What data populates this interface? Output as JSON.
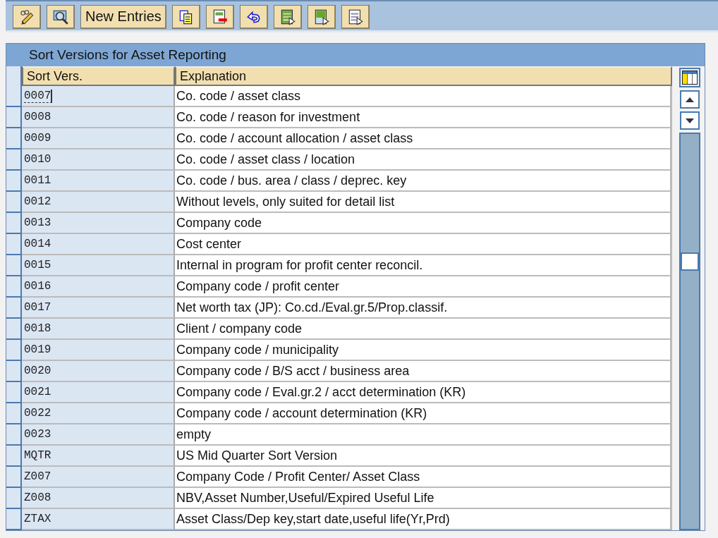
{
  "toolbar": {
    "buttons": [
      {
        "kind": "edit"
      },
      {
        "kind": "display"
      },
      {
        "kind": "text",
        "label": "New Entries"
      },
      {
        "kind": "copy"
      },
      {
        "kind": "delete"
      },
      {
        "kind": "undo"
      },
      {
        "kind": "select-all"
      },
      {
        "kind": "select-block"
      },
      {
        "kind": "deselect"
      }
    ]
  },
  "table": {
    "title": "Sort Versions for Asset Reporting",
    "columns": [
      "Sort Vers.",
      "Explanation"
    ],
    "rows": [
      {
        "code": "0007",
        "explanation": "Co. code / asset class",
        "focused": true
      },
      {
        "code": "0008",
        "explanation": "Co. code / reason for investment",
        "focused": false
      },
      {
        "code": "0009",
        "explanation": "Co. code / account allocation / asset class",
        "focused": false
      },
      {
        "code": "0010",
        "explanation": "Co. code / asset class / location",
        "focused": false
      },
      {
        "code": "0011",
        "explanation": "Co. code / bus. area / class / deprec. key",
        "focused": false
      },
      {
        "code": "0012",
        "explanation": "Without levels, only suited for detail list",
        "focused": false
      },
      {
        "code": "0013",
        "explanation": "Company code",
        "focused": false
      },
      {
        "code": "0014",
        "explanation": "Cost center",
        "focused": false
      },
      {
        "code": "0015",
        "explanation": "Internal in program for profit center reconcil.",
        "focused": false
      },
      {
        "code": "0016",
        "explanation": "Company code / profit center",
        "focused": false
      },
      {
        "code": "0017",
        "explanation": "Net worth tax (JP): Co.cd./Eval.gr.5/Prop.classif.",
        "focused": false
      },
      {
        "code": "0018",
        "explanation": "Client / company code",
        "focused": false
      },
      {
        "code": "0019",
        "explanation": "Company code / municipality",
        "focused": false
      },
      {
        "code": "0020",
        "explanation": "Company code / B/S acct / business area",
        "focused": false
      },
      {
        "code": "0021",
        "explanation": "Company code / Eval.gr.2 / acct determination (KR)",
        "focused": false
      },
      {
        "code": "0022",
        "explanation": "Company code / account determination (KR)",
        "focused": false
      },
      {
        "code": "0023",
        "explanation": "empty",
        "focused": false
      },
      {
        "code": "MQTR",
        "explanation": "US Mid Quarter Sort Version",
        "focused": false
      },
      {
        "code": "Z007",
        "explanation": "Company Code / Profit Center/ Asset Class",
        "focused": false
      },
      {
        "code": "Z008",
        "explanation": "NBV,Asset Number,Useful/Expired Useful Life",
        "focused": false
      },
      {
        "code": "ZTAX",
        "explanation": "Asset Class/Dep key,start date,useful life(Yr,Prd)",
        "focused": false
      }
    ]
  }
}
